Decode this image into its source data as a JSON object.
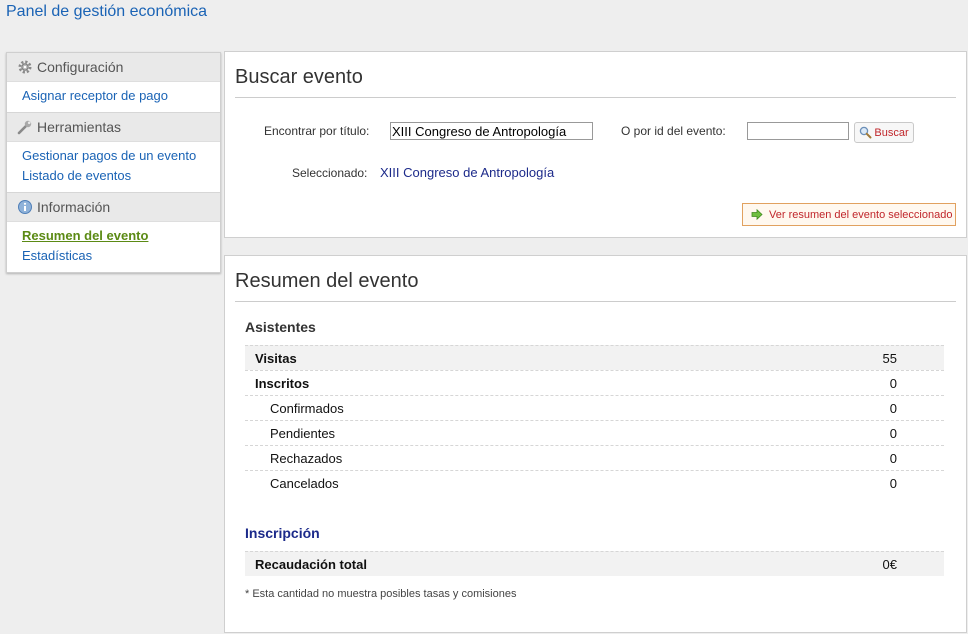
{
  "app_title": "Panel de gestión económica",
  "sidebar": {
    "sections": [
      {
        "title": "Configuración",
        "icon": "gear-icon",
        "items": [
          {
            "label": "Asignar receptor de pago"
          }
        ]
      },
      {
        "title": "Herramientas",
        "icon": "wrench-icon",
        "items": [
          {
            "label": "Gestionar pagos de un evento"
          },
          {
            "label": "Listado de eventos"
          }
        ]
      },
      {
        "title": "Información",
        "icon": "info-icon",
        "items": [
          {
            "label": "Resumen del evento",
            "active": true
          },
          {
            "label": "Estadísticas"
          }
        ]
      }
    ]
  },
  "search": {
    "title": "Buscar evento",
    "title_label": "Encontrar por título:",
    "title_value": "XIII Congreso de Antropología",
    "id_label": "O por id del evento:",
    "id_value": "",
    "search_button": "Buscar",
    "selected_label": "Seleccionado:",
    "selected_value": "XIII Congreso de Antropología",
    "summary_button": "Ver resumen del evento seleccionado"
  },
  "summary": {
    "title": "Resumen del evento",
    "attendees_title": "Asistentes",
    "attendees": [
      {
        "label": "Visitas",
        "value": "55"
      },
      {
        "label": "Inscritos",
        "value": "0"
      },
      {
        "label": "Confirmados",
        "value": "0"
      },
      {
        "label": "Pendientes",
        "value": "0"
      },
      {
        "label": "Rechazados",
        "value": "0"
      },
      {
        "label": "Cancelados",
        "value": "0"
      }
    ],
    "registration_title": "Inscripción",
    "registration": [
      {
        "label": "Recaudación total",
        "value": "0€"
      }
    ],
    "footnote": "* Esta cantidad no muestra posibles tasas y comisiones"
  },
  "colors": {
    "link": "#1a63b5",
    "active_link": "#5b8a14",
    "button_text": "#c0262b",
    "section_accent": "#1c2a8a"
  }
}
